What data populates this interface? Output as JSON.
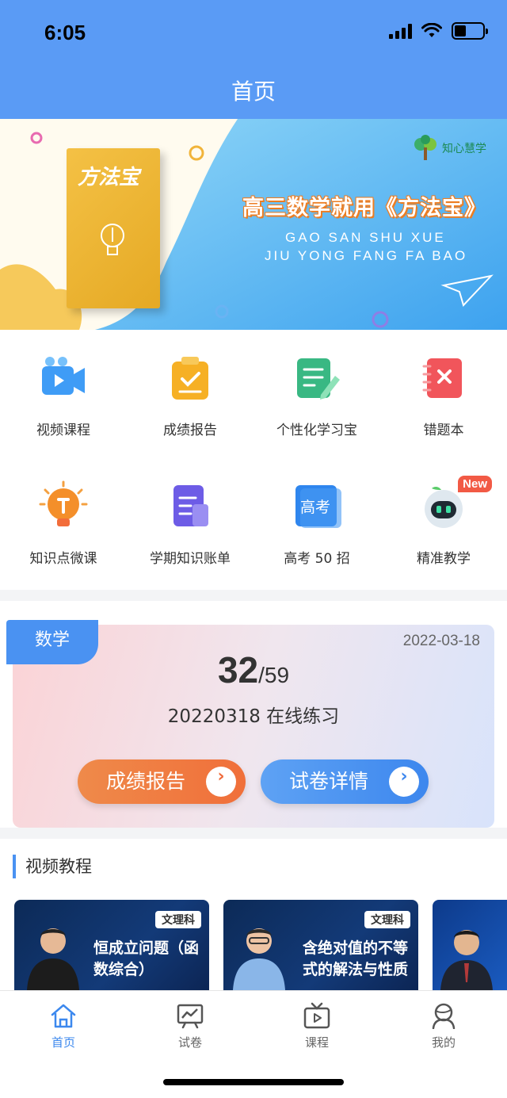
{
  "status_bar": {
    "time": "6:05"
  },
  "nav": {
    "title": "首页"
  },
  "banner": {
    "book_title": "方法宝",
    "logo_text": "知心慧学",
    "headline": "高三数学就用《方法宝》",
    "line1": "GAO SAN SHU XUE",
    "line2": "JIU YONG FANG FA BAO"
  },
  "grid": {
    "items": [
      {
        "label": "视频课程",
        "icon": "video-camera-icon"
      },
      {
        "label": "成绩报告",
        "icon": "clipboard-check-icon"
      },
      {
        "label": "个性化学习宝",
        "icon": "notebook-pen-icon"
      },
      {
        "label": "错题本",
        "icon": "wrong-notebook-icon"
      },
      {
        "label": "知识点微课",
        "icon": "lightbulb-icon"
      },
      {
        "label": "学期知识账单",
        "icon": "document-list-icon"
      },
      {
        "label": "高考 50 招",
        "icon": "gaokao-book-icon",
        "icon_text": "高考"
      },
      {
        "label": "精准教学",
        "icon": "robot-icon",
        "badge": "New"
      }
    ]
  },
  "practice": {
    "subject": "数学",
    "date": "2022-03-18",
    "score": "32",
    "total": "/59",
    "name": "20220318 在线练习",
    "report_button": "成绩报告",
    "detail_button": "试卷详情"
  },
  "videos": {
    "section_title": "视频教程",
    "items": [
      {
        "tag": "文理科",
        "title": "恒成立问题（函数综合）"
      },
      {
        "tag": "文理科",
        "title": "含绝对值的不等式的解法与性质"
      }
    ]
  },
  "tabbar": {
    "items": [
      {
        "label": "首页",
        "active": true
      },
      {
        "label": "试卷"
      },
      {
        "label": "课程"
      },
      {
        "label": "我的"
      }
    ]
  },
  "colors": {
    "primary": "#5a9bf5",
    "accent_blue": "#3c88ee",
    "accent_orange": "#f06f3a"
  }
}
